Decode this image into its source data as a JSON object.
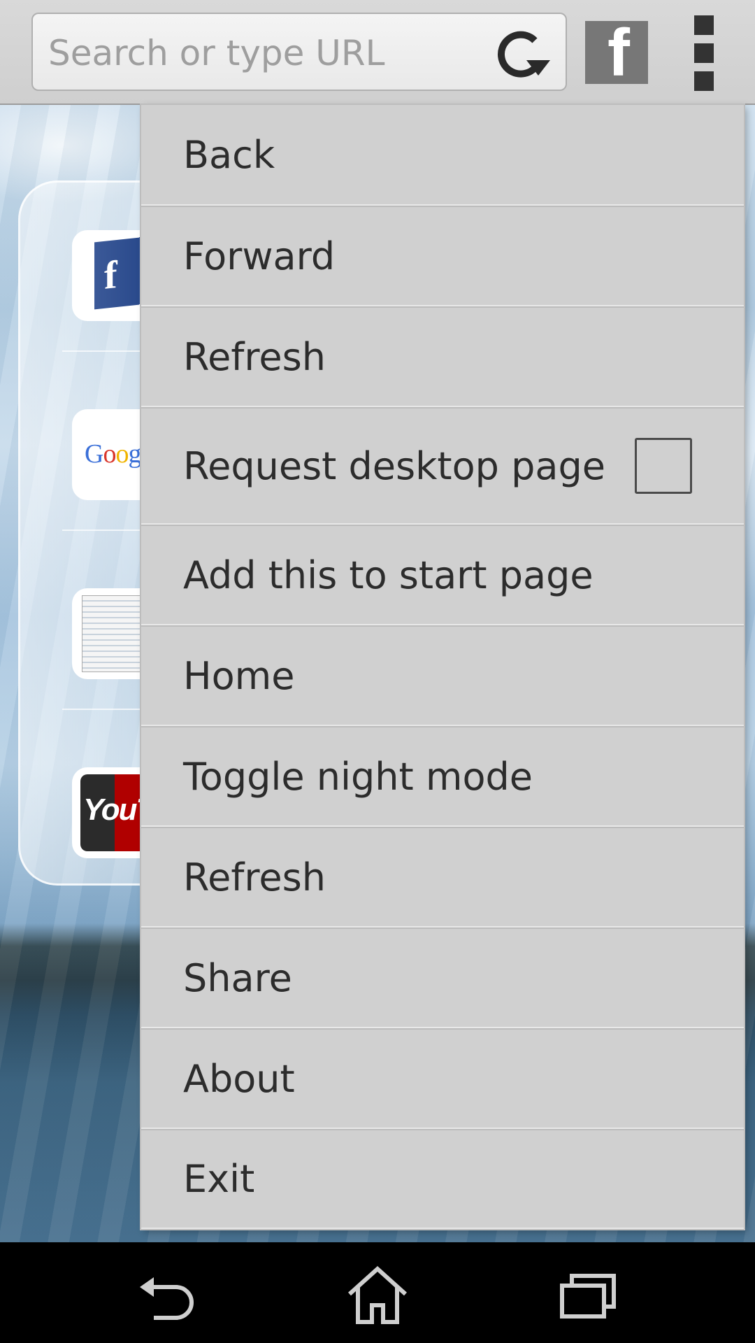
{
  "toolbar": {
    "search_placeholder": "Search or type URL",
    "search_value": "",
    "reload_icon": "reload-icon",
    "facebook_label": "f",
    "overflow_icon": "overflow-menu-icon"
  },
  "speed_dial": {
    "tiles": [
      {
        "name": "facebook",
        "logo_text": "f"
      },
      {
        "name": "google",
        "logo_text": "Google"
      },
      {
        "name": "web-page-thumbnail",
        "logo_text": ""
      },
      {
        "name": "youtube",
        "logo_text": "YouTube"
      }
    ]
  },
  "menu": {
    "items": [
      {
        "label": "Back"
      },
      {
        "label": "Forward"
      },
      {
        "label": "Refresh"
      },
      {
        "label": "Request desktop page",
        "checkbox": true,
        "checked": false
      },
      {
        "label": "Add this to start page"
      },
      {
        "label": "Home"
      },
      {
        "label": "Toggle night mode"
      },
      {
        "label": "Refresh"
      },
      {
        "label": "Share"
      },
      {
        "label": "About"
      },
      {
        "label": "Exit"
      }
    ]
  },
  "navbar": {
    "buttons": [
      "back-icon",
      "home-icon",
      "recent-apps-icon"
    ]
  },
  "colors": {
    "toolbar_bg": "#d4d4d4",
    "menu_bg": "#d0d0d0",
    "menu_text": "#2c2c2c",
    "navbar_bg": "#000000"
  }
}
